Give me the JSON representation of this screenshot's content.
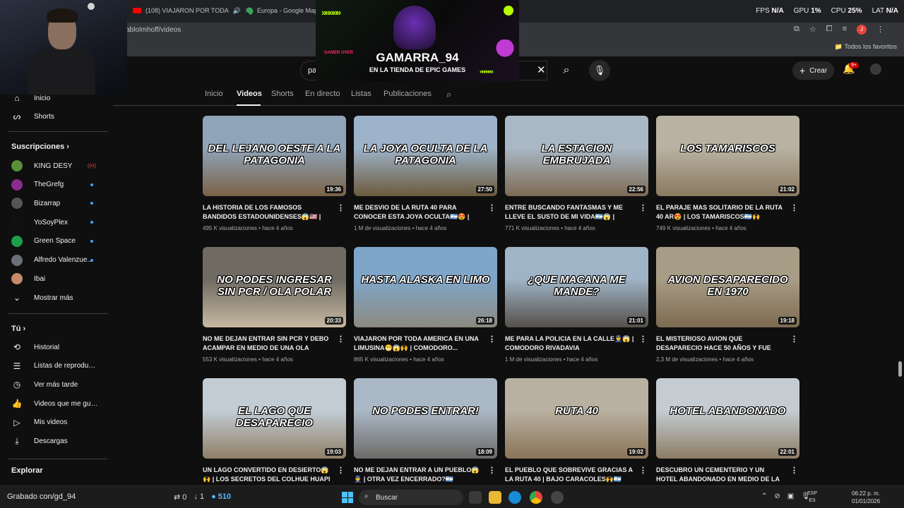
{
  "browser": {
    "tabs": [
      {
        "label": "(108) VIAJARON POR TODA"
      },
      {
        "label": "Europa - Google Maps"
      }
    ],
    "url": "abloImhoff/videos",
    "bookmarks_label": "Todos los favoritos",
    "account_initial": "J"
  },
  "perf_overlay": {
    "fps_label": "FPS",
    "fps_value": "N/A",
    "gpu_label": "GPU",
    "gpu_value": "1%",
    "cpu_label": "CPU",
    "cpu_value": "25%",
    "lat_label": "LAT",
    "lat_value": "N/A"
  },
  "banner": {
    "title": "GAMARRA_94",
    "subtitle": "EN LA TIENDA DE EPIC GAMES",
    "badge": "GAMER OVER"
  },
  "header": {
    "search_value": "pa",
    "create_label": "Crear",
    "notifications_badge": "9+"
  },
  "sidebar": {
    "top_items": [
      {
        "label": "Inicio",
        "icon": "home-icon"
      },
      {
        "label": "Shorts",
        "icon": "shorts-icon"
      }
    ],
    "subscriptions_title": "Suscripciones",
    "subscriptions": [
      {
        "label": "KING DESY",
        "color": "#5a8f3a",
        "status": "live"
      },
      {
        "label": "TheGrefg",
        "color": "#8a2b8f",
        "status": "new"
      },
      {
        "label": "Bizarrap",
        "color": "#555555",
        "status": "new"
      },
      {
        "label": "YoSoyPlex",
        "color": "#111111",
        "status": "new"
      },
      {
        "label": "Green Space",
        "color": "#1e9e4a",
        "status": "new"
      },
      {
        "label": "Alfredo Valenzue...",
        "color": "#6b6f7a",
        "status": "new"
      },
      {
        "label": "Ibai",
        "color": "#c78a6a",
        "status": "none"
      }
    ],
    "show_more_label": "Mostrar más",
    "you_title": "Tú",
    "you_items": [
      {
        "label": "Historial",
        "icon": "history-icon"
      },
      {
        "label": "Listas de reproducc...",
        "icon": "playlist-icon"
      },
      {
        "label": "Ver más tarde",
        "icon": "clock-icon"
      },
      {
        "label": "Videos que me gus...",
        "icon": "thumbs-up-icon"
      },
      {
        "label": "Mis videos",
        "icon": "my-videos-icon"
      },
      {
        "label": "Descargas",
        "icon": "download-icon"
      }
    ],
    "explore_title": "Explorar",
    "live_badge": "((•))"
  },
  "channel_tabs": [
    "Inicio",
    "Videos",
    "Shorts",
    "En directo",
    "Listas",
    "Publicaciones"
  ],
  "videos": [
    {
      "thumb_text": "DEL LEJANO OESTE A LA PATAGONIA",
      "colors": [
        "#8fa4b8",
        "#7a6248"
      ],
      "duration": "19:36",
      "title": "LA HISTORIA DE LOS FAMOSOS BANDIDOS ESTADOUNIDENSES😱🇺🇸 | Butch Cassidy...",
      "views": "495 K visualizaciones",
      "age": "hace 4 años"
    },
    {
      "thumb_text": "LA JOYA OCULTA DE LA PATAGONIA",
      "colors": [
        "#9db3c9",
        "#6c5a3e"
      ],
      "duration": "27:50",
      "title": "ME DESVIO DE LA RUTA 40 PARA CONOCER ESTA JOYA OCULTA🇦🇷😍 | CHOLILA",
      "views": "1 M de visualizaciones",
      "age": "hace 4 años"
    },
    {
      "thumb_text": "LA ESTACION EMBRUJADA",
      "colors": [
        "#a9b8c4",
        "#7d6a55"
      ],
      "duration": "22:56",
      "title": "ENTRE BUSCANDO FANTASMAS Y ME LLEVE EL SUSTO DE MI VIDA🇦🇷😱 | RUTA...",
      "views": "771 K visualizaciones",
      "age": "hace 4 años"
    },
    {
      "thumb_text": "LOS TAMARISCOS",
      "colors": [
        "#b9b2a2",
        "#8a7a60"
      ],
      "duration": "21:02",
      "title": "EL PARAJE MAS SOLITARIO DE LA RUTA 40 AR😍 | LOS TAMARISCOS🇦🇷🙌",
      "views": "749 K visualizaciones",
      "age": "hace 4 años"
    },
    {
      "thumb_text": "NO PODES INGRESAR SIN PCR / OLA POLAR",
      "colors": [
        "#6f6a62",
        "#c7b8a2"
      ],
      "duration": "20:33",
      "title": "NO ME DEJAN ENTRAR SIN PCR Y DEBO ACAMPAR EN MEDIO DE UNA OLA POLAR...",
      "views": "553 K visualizaciones",
      "age": "hace 4 años"
    },
    {
      "thumb_text": "HASTA ALASKA EN LIMO",
      "colors": [
        "#7fa6c8",
        "#8d8a80"
      ],
      "duration": "26:18",
      "title": "VIAJARON POR TODA AMERICA EN UNA LIMUSINA😁😱🙌 | COMODORO...",
      "views": "865 K visualizaciones",
      "age": "hace 4 años"
    },
    {
      "thumb_text": "¿QUE MACANA ME MANDE?",
      "colors": [
        "#9fb4c6",
        "#55504a"
      ],
      "duration": "21:01",
      "title": "ME PARA LA POLICIA EN LA CALLE👮😱 | COMODORO RIVADAVIA",
      "views": "1 M de visualizaciones",
      "age": "hace 4 años"
    },
    {
      "thumb_text": "AVION DESAPARECIDO EN 1970",
      "colors": [
        "#a79c86",
        "#7c6a50"
      ],
      "duration": "19:18",
      "title": "EL MISTERIOSO AVION QUE DESAPARECIO HACE 50 AÑOS Y FUE ENCONTRADO EN U...",
      "views": "2,3 M de visualizaciones",
      "age": "hace 4 años"
    },
    {
      "thumb_text": "EL LAGO QUE DESAPARECIO",
      "colors": [
        "#c2ccd4",
        "#8f7f66"
      ],
      "duration": "19:03",
      "title": "UN LAGO CONVERTIDO EN DESIERTO😱🙌 | LOS SECRETOS DEL COLHUE HUAPI🇦🇷",
      "views": "",
      "age": ""
    },
    {
      "thumb_text": "NO PODES ENTRAR!",
      "colors": [
        "#aab8c6",
        "#6d6a66"
      ],
      "duration": "18:09",
      "title": "NO ME DEJAN ENTRAR A UN PUEBLO😱👮 | OTRA VEZ ENCERRADO?🇦🇷",
      "views": "",
      "age": ""
    },
    {
      "thumb_text": "RUTA 40",
      "colors": [
        "#b8b0a0",
        "#8a7458"
      ],
      "duration": "19:02",
      "title": "EL PUEBLO QUE SOBREVIVE GRACIAS A LA RUTA 40 | BAJO CARACOLES🙌🇦🇷",
      "views": "",
      "age": ""
    },
    {
      "thumb_text": "HOTEL ABANDONADO",
      "colors": [
        "#c4ccd2",
        "#8c7c64"
      ],
      "duration": "22:01",
      "title": "DESCUBRO UN CEMENTERIO Y UN HOTEL ABANDONADO EN MEDIO DE LA RUTA 40...",
      "views": "",
      "age": ""
    }
  ],
  "taskbar": {
    "watermark": "Grabado con/gd_94",
    "stat_a": "0",
    "stat_b": "1",
    "stat_c": "510",
    "search_label": "Buscar",
    "lang_top": "ESP",
    "lang_bottom": "ES",
    "time": "06:22 p. m.",
    "date": "01/01/2026"
  }
}
